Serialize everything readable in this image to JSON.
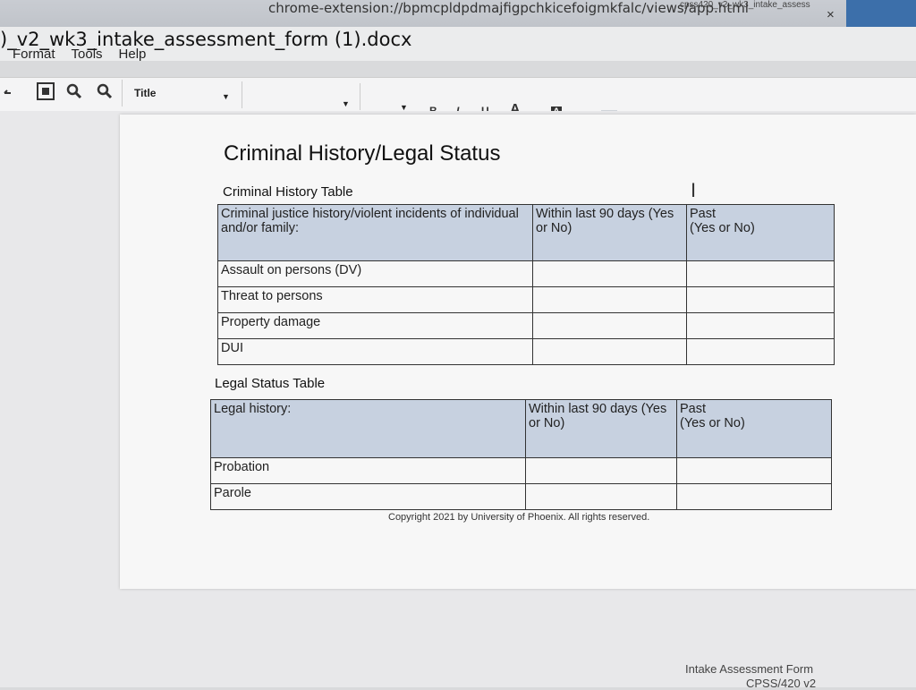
{
  "browser": {
    "url": "chrome-extension://bpmcpldpdmajfigpchkicefoigmkfalc/views/app.html",
    "tab_title_fragment": "cpss420_v2_wk3_intake_assess",
    "close_glyph": "×"
  },
  "document": {
    "filename": ")_v2_wk3_intake_assessment_form (1).docx"
  },
  "menu": [
    "Format",
    "Tools",
    "Help"
  ],
  "toolbar": {
    "paragraph_style": "Title",
    "bold": "B",
    "italic": "I",
    "underline": "U",
    "font_color": "A",
    "highlight": "A"
  },
  "content": {
    "heading": "Criminal History/Legal Status",
    "table1_caption": "Criminal History Table",
    "table1": {
      "headers": [
        "Criminal justice history/violent incidents of individual and/or family:",
        "Within last 90 days (Yes or No)",
        "Past\n(Yes or No)"
      ],
      "rows": [
        "Assault on persons (DV)",
        "Threat to persons",
        "Property damage",
        "DUI"
      ]
    },
    "table2_caption": "Legal Status Table",
    "table2": {
      "headers": [
        "Legal history:",
        "Within last 90 days (Yes or No)",
        "Past\n(Yes or No)"
      ],
      "rows": [
        "Probation",
        "Parole"
      ]
    },
    "copyright": "Copyright 2021 by University of Phoenix. All rights reserved."
  },
  "footer": {
    "line1": "Intake Assessment Form",
    "line2": "CPSS/420 v2"
  },
  "colors": {
    "header_fill": "#c7d1e0",
    "accent_tab": "#3c6faa",
    "font_color_underline": "#d40000"
  },
  "icons": [
    "undo-icon",
    "fit-page-icon",
    "zoom-in-icon",
    "zoom-out-icon",
    "align-left-icon",
    "align-center-icon",
    "align-right-icon",
    "justify-icon",
    "numbered-list-icon",
    "bullet-list-icon"
  ]
}
